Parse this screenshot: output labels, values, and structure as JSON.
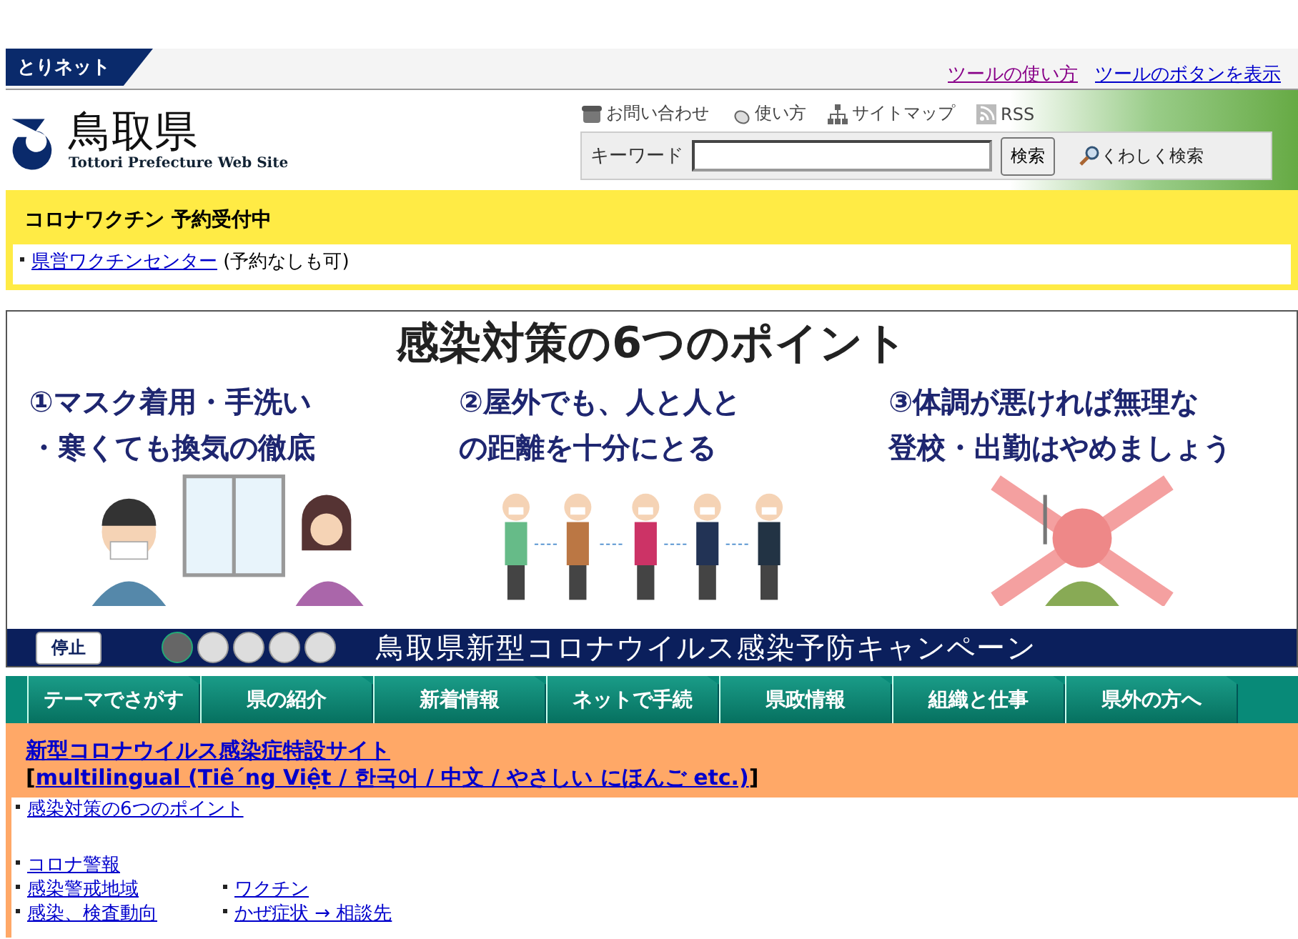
{
  "top_bar": {
    "badge": "とりネット",
    "links": [
      {
        "label": "ツールの使い方",
        "visited": true
      },
      {
        "label": "ツールのボタンを表示",
        "visited": false
      }
    ]
  },
  "header": {
    "logo_title": "鳥取県",
    "logo_subtitle": "Tottori Prefecture Web Site",
    "utility_links": [
      {
        "label": "お問い合わせ",
        "kind": "phone"
      },
      {
        "label": "使い方",
        "kind": "mouse"
      },
      {
        "label": "サイトマップ",
        "kind": "sitemap"
      },
      {
        "label": "RSS",
        "kind": "rss"
      }
    ],
    "search": {
      "label": "キーワード",
      "button": "検索",
      "advanced": "くわしく検索"
    }
  },
  "notice": {
    "title": "コロナワクチン 予約受付中",
    "link": "県営ワクチンセンター",
    "note": "(予約なしも可)"
  },
  "banner": {
    "title": "感染対策の6つのポイント",
    "points": [
      [
        "①マスク着用・手洗い",
        "・寒くても換気の徹底"
      ],
      [
        "②屋外でも、人と人と",
        "の距離を十分にとる"
      ],
      [
        "③体調が悪ければ無理な",
        "登校・出勤はやめましょう"
      ]
    ],
    "stop_button": "停止",
    "slides": [
      {
        "selected": true
      },
      {
        "selected": false
      },
      {
        "selected": false
      },
      {
        "selected": false
      },
      {
        "selected": false
      }
    ],
    "caption": "鳥取県新型コロナウイルス感染予防キャンペーン"
  },
  "nav": [
    "テーマでさがす",
    "県の紹介",
    "新着情報",
    "ネットで手続",
    "県政情報",
    "組織と仕事",
    "県外の方へ"
  ],
  "corona": {
    "title": "新型コロナウイルス感染症特設サイト",
    "bracket_open": "[",
    "bracket_close": "]",
    "multilingual": "multilingual (Tiê´ng Việt / 한국어 / 中文 / やさしい にほんご etc.)",
    "first_link": "感染対策の6つのポイント",
    "links_left": [
      "コロナ警報",
      "感染警戒地域",
      "感染、検査動向"
    ],
    "links_right": [
      "ワクチン",
      "かぜ症状 → 相談先"
    ]
  }
}
